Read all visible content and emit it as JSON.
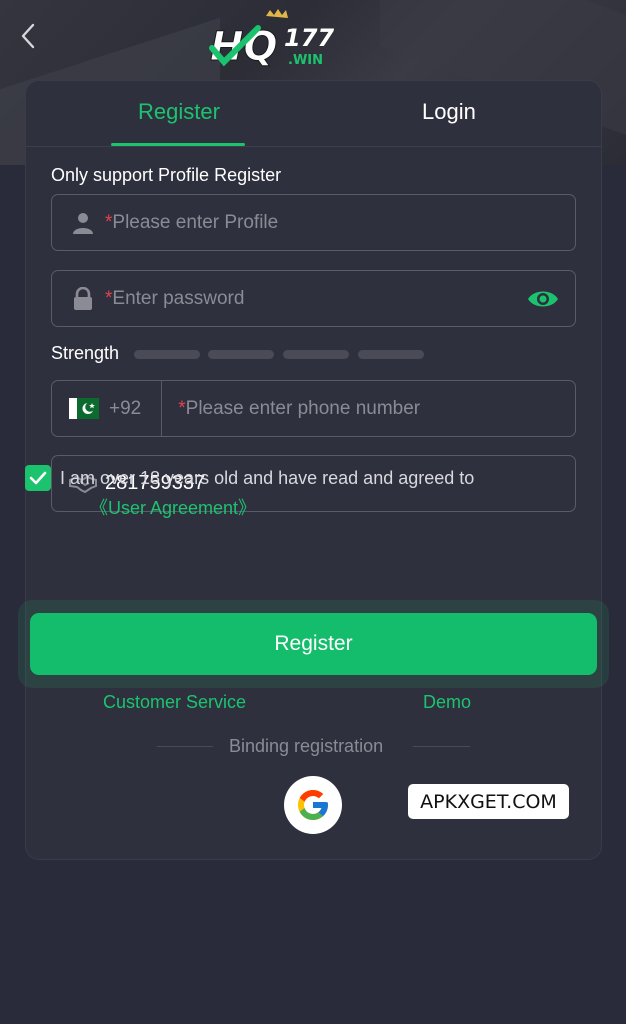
{
  "brand": {
    "logo_main": "HQ",
    "logo_number": "177",
    "logo_suffix": ".WIN"
  },
  "tabs": [
    {
      "label": "Register",
      "active": true
    },
    {
      "label": "Login",
      "active": false
    }
  ],
  "form": {
    "hint": "Only support Profile Register",
    "profile_placeholder": "Please enter Profile",
    "password_placeholder": "Enter password",
    "required_mark": "*",
    "strength_label": "Strength",
    "strength_bars": 4,
    "phone_code": "+92",
    "phone_placeholder": "Please enter phone number",
    "invite_code": "281759337"
  },
  "agreement": {
    "checked": true,
    "text": "I am over 18 years old and have read and agreed to",
    "link": "《User Agreement》"
  },
  "register_button": "Register",
  "links": {
    "customer_service": "Customer Service",
    "demo": "Demo"
  },
  "binding_label": "Binding registration",
  "watermark": "APKXGET.COM",
  "colors": {
    "accent": "#1cc36f",
    "background": "#2a2b3a",
    "card": "#2f303e",
    "required": "#e0444d"
  },
  "icons": [
    "back-arrow-icon",
    "user-icon",
    "lock-icon",
    "eye-icon",
    "pakistan-flag-icon",
    "handshake-icon",
    "check-icon",
    "google-icon"
  ]
}
